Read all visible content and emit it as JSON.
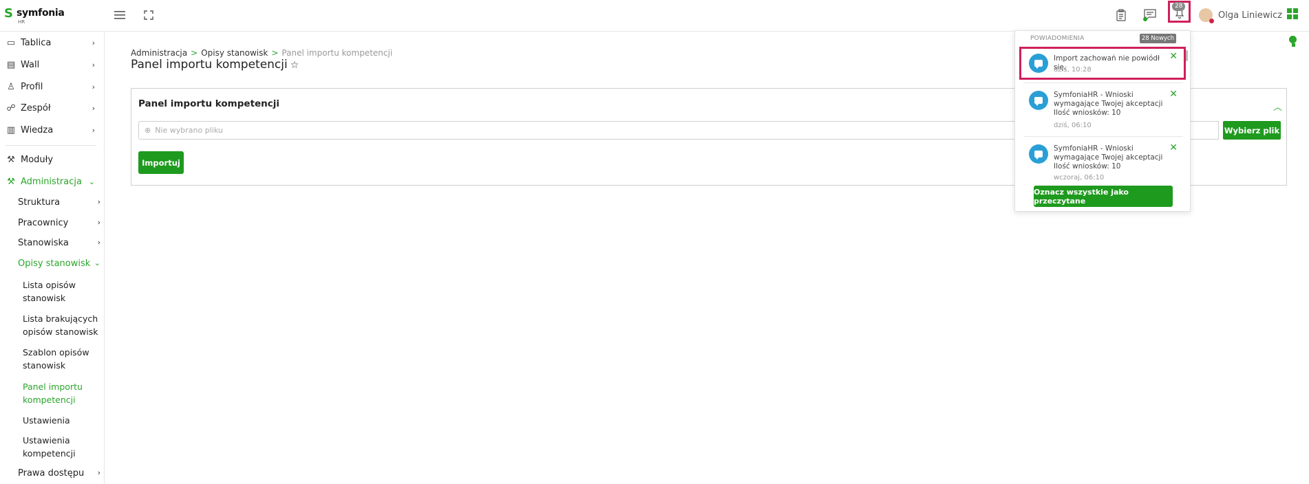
{
  "brand": {
    "name": "symfonia",
    "sub": "HR"
  },
  "topbar": {
    "bell_badge": "28",
    "user_name": "Olga Liniewicz"
  },
  "sidebar": {
    "items": [
      {
        "label": "Tablica",
        "icon": "monitor-icon"
      },
      {
        "label": "Wall",
        "icon": "wall-icon"
      },
      {
        "label": "Profil",
        "icon": "user-icon"
      },
      {
        "label": "Zespół",
        "icon": "team-icon"
      },
      {
        "label": "Wiedza",
        "icon": "book-icon"
      },
      {
        "label": "Moduły",
        "icon": "wrench-icon"
      },
      {
        "label": "Administracja",
        "icon": "wrench-icon"
      }
    ],
    "admin_sub": [
      {
        "label": "Struktura"
      },
      {
        "label": "Pracownicy"
      },
      {
        "label": "Stanowiska"
      },
      {
        "label": "Opisy stanowisk"
      }
    ],
    "opisy_leaves": [
      {
        "label": "Lista opisów stanowisk"
      },
      {
        "label": "Lista brakujących opisów stanowisk"
      },
      {
        "label": "Szablon opisów stanowisk"
      },
      {
        "label": "Panel importu kompetencji"
      },
      {
        "label": "Ustawienia"
      },
      {
        "label": "Ustawienia kompetencji"
      }
    ],
    "last": {
      "label": "Prawa dostępu"
    }
  },
  "breadcrumb": {
    "items": [
      "Administracja",
      "Opisy stanowisk",
      "Panel importu kompetencji"
    ],
    "separator": ">"
  },
  "page_title": "Panel importu kompetencji",
  "panel": {
    "title": "Panel importu kompetencji",
    "file_placeholder": "Nie wybrano pliku",
    "choose_label": "Wybierz plik",
    "import_label": "Importuj"
  },
  "notifications": {
    "header": "POWIADOMIENIA",
    "badge": "28 Nowych",
    "items": [
      {
        "text": "Import zachowań nie powiódł się.",
        "time": "dziś, 10:28"
      },
      {
        "text": "SymfoniaHR - Wnioski wymagające Twojej akceptacji Ilość wniosków: 10",
        "time": "dziś, 06:10"
      },
      {
        "text": "SymfoniaHR - Wnioski wymagające Twojej akceptacji Ilość wniosków: 10",
        "time": "wczoraj, 06:10"
      }
    ],
    "mark_all_label": "Oznacz wszystkie jako przeczytane"
  },
  "colors": {
    "accent": "#1e9a1e",
    "highlight": "#cf1f5c",
    "notif_avatar": "#2a9fd6"
  }
}
